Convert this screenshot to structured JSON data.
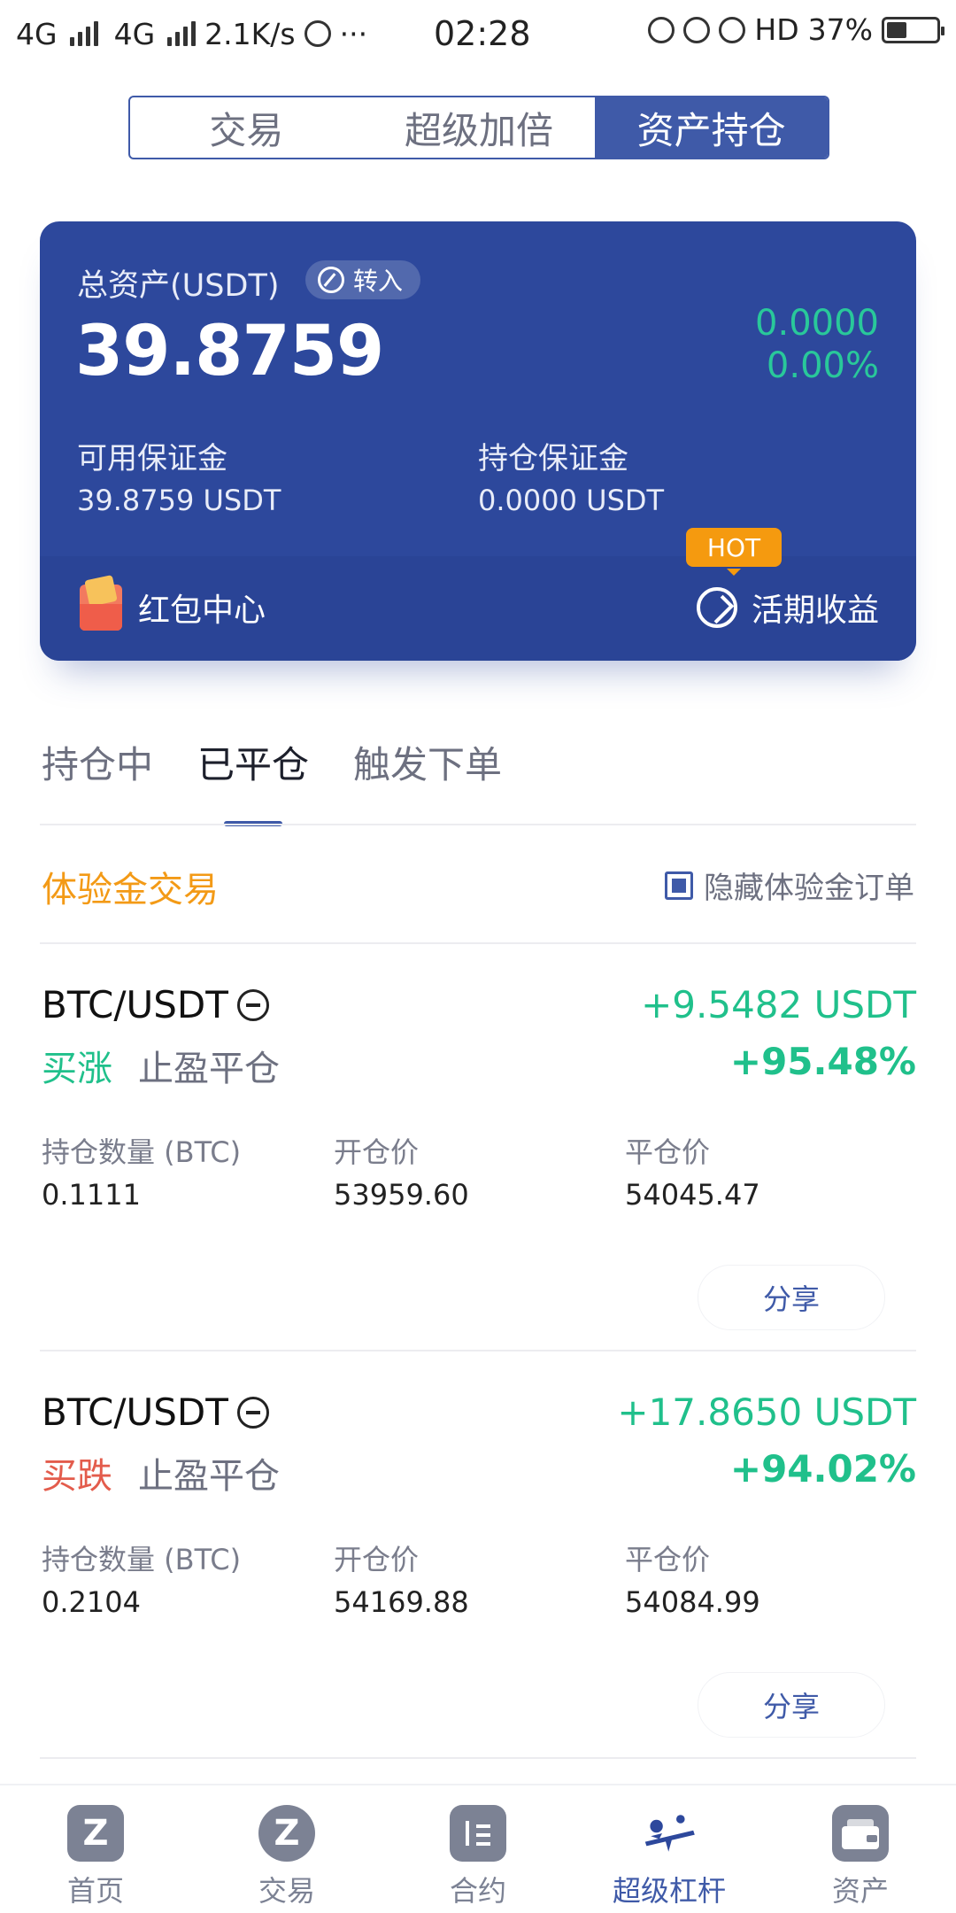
{
  "status_bar": {
    "network": "4G",
    "network2": "4G",
    "speed": "2.1K/s",
    "more": "···",
    "time": "02:28",
    "hd": "HD",
    "battery": "37%"
  },
  "segment": {
    "items": [
      {
        "label": "交易",
        "active": false
      },
      {
        "label": "超级加倍",
        "active": false
      },
      {
        "label": "资产持仓",
        "active": true
      }
    ]
  },
  "asset_card": {
    "total_label": "总资产(USDT)",
    "transfer_label": "转入",
    "total_value": "39.8759",
    "pnl_amount": "0.0000",
    "pnl_percent": "0.00%",
    "available_margin_label": "可用保证金",
    "available_margin_value": "39.8759 USDT",
    "position_margin_label": "持仓保证金",
    "position_margin_value": "0.0000 USDT",
    "redpacket_label": "红包中心",
    "hot_badge": "HOT",
    "earn_label": "活期收益"
  },
  "tabs": [
    {
      "label": "持仓中",
      "active": false
    },
    {
      "label": "已平仓",
      "active": true
    },
    {
      "label": "触发下单",
      "active": false
    }
  ],
  "trial": {
    "title": "体验金交易",
    "hide_label": "隐藏体验金订单"
  },
  "orders": [
    {
      "pair": "BTC/USDT",
      "side": "买涨",
      "side_type": "buy",
      "status": "止盈平仓",
      "pnl_usdt": "+9.5482 USDT",
      "pnl_rate": "+95.48%",
      "qty_label": "持仓数量 (BTC)",
      "qty_value": "0.1111",
      "open_label": "开仓价",
      "open_value": "53959.60",
      "close_label": "平仓价",
      "close_value": "54045.47",
      "share_label": "分享"
    },
    {
      "pair": "BTC/USDT",
      "side": "买跌",
      "side_type": "sell",
      "status": "止盈平仓",
      "pnl_usdt": "+17.8650 USDT",
      "pnl_rate": "+94.02%",
      "qty_label": "持仓数量 (BTC)",
      "qty_value": "0.2104",
      "open_label": "开仓价",
      "open_value": "54169.88",
      "close_label": "平仓价",
      "close_value": "54084.99",
      "share_label": "分享"
    }
  ],
  "bottom_nav": [
    {
      "label": "首页",
      "icon": "home-icon",
      "active": false
    },
    {
      "label": "交易",
      "icon": "trade-icon",
      "active": false
    },
    {
      "label": "合约",
      "icon": "contract-icon",
      "active": false
    },
    {
      "label": "超级杠杆",
      "icon": "super-leverage-icon",
      "active": true
    },
    {
      "label": "资产",
      "icon": "wallet-icon",
      "active": false
    }
  ],
  "colors": {
    "brand": "#3f5aa8",
    "card": "#2d489c",
    "profit": "#20c08b",
    "loss": "#e35c4c",
    "accent": "#f39a16"
  }
}
